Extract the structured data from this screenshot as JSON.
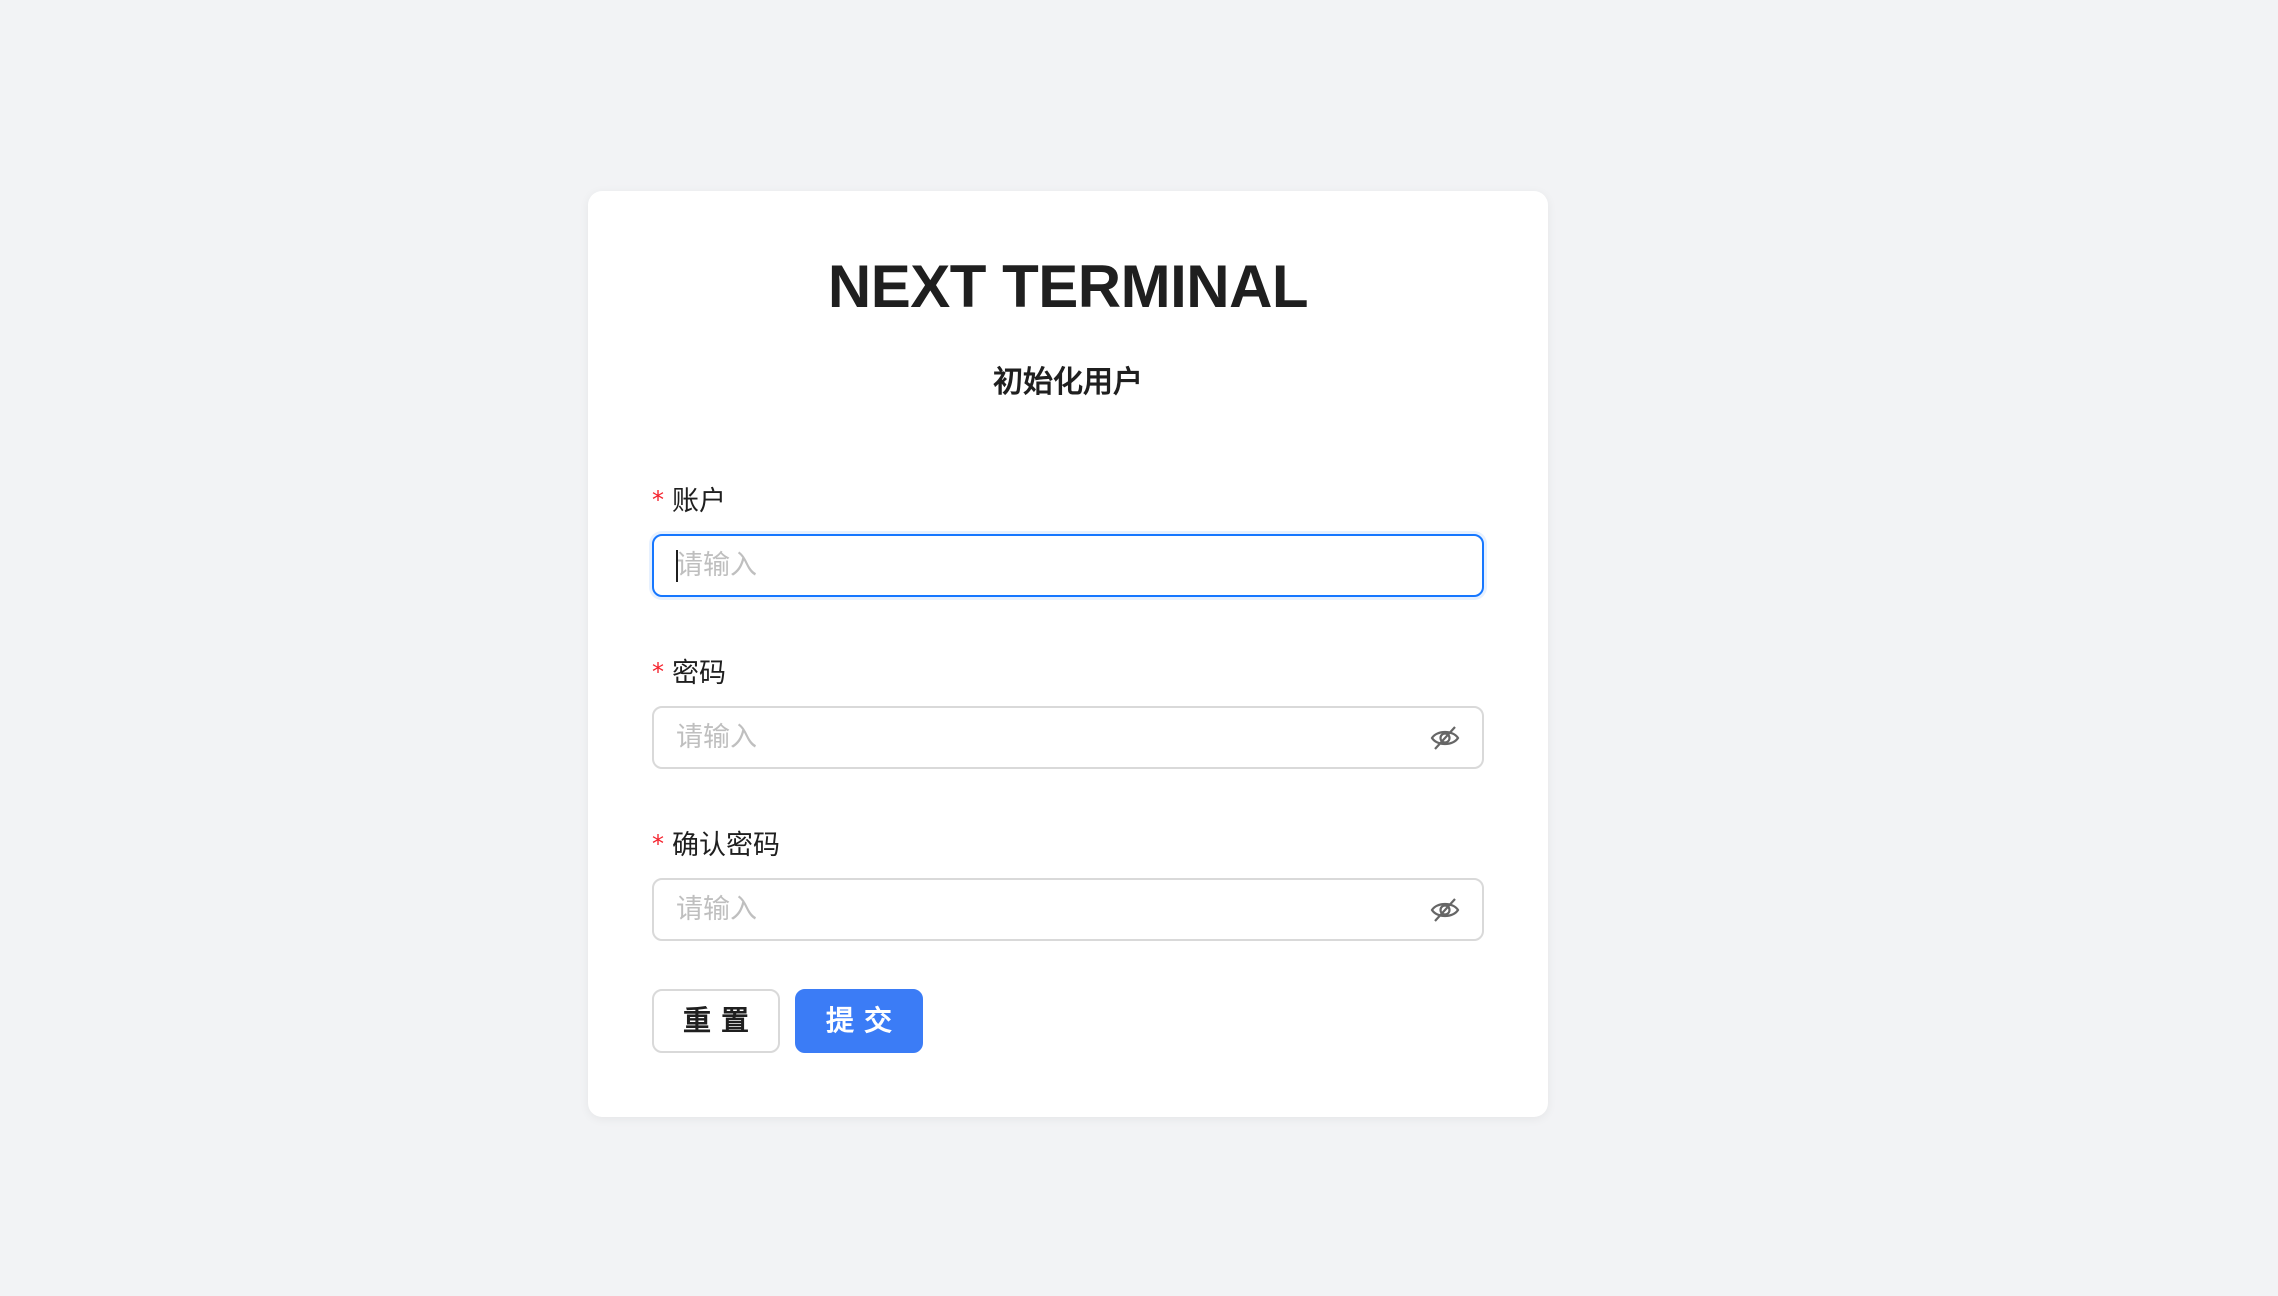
{
  "app": {
    "title": "NEXT TERMINAL",
    "subtitle": "初始化用户"
  },
  "form": {
    "required_mark": "*",
    "fields": [
      {
        "label": "账户",
        "placeholder": "请输入",
        "value": "",
        "type": "text",
        "focused": true
      },
      {
        "label": "密码",
        "placeholder": "请输入",
        "value": "",
        "type": "password",
        "icon": "eye-invisible-icon"
      },
      {
        "label": "确认密码",
        "placeholder": "请输入",
        "value": "",
        "type": "password",
        "icon": "eye-invisible-icon"
      }
    ],
    "buttons": {
      "reset_label": "重置",
      "submit_label": "提交"
    }
  },
  "colors": {
    "background": "#f2f3f5",
    "card": "#ffffff",
    "primary": "#3b7cf6",
    "focus_border": "#1677ff",
    "required": "#f5222d",
    "placeholder": "#bfbfbf"
  }
}
